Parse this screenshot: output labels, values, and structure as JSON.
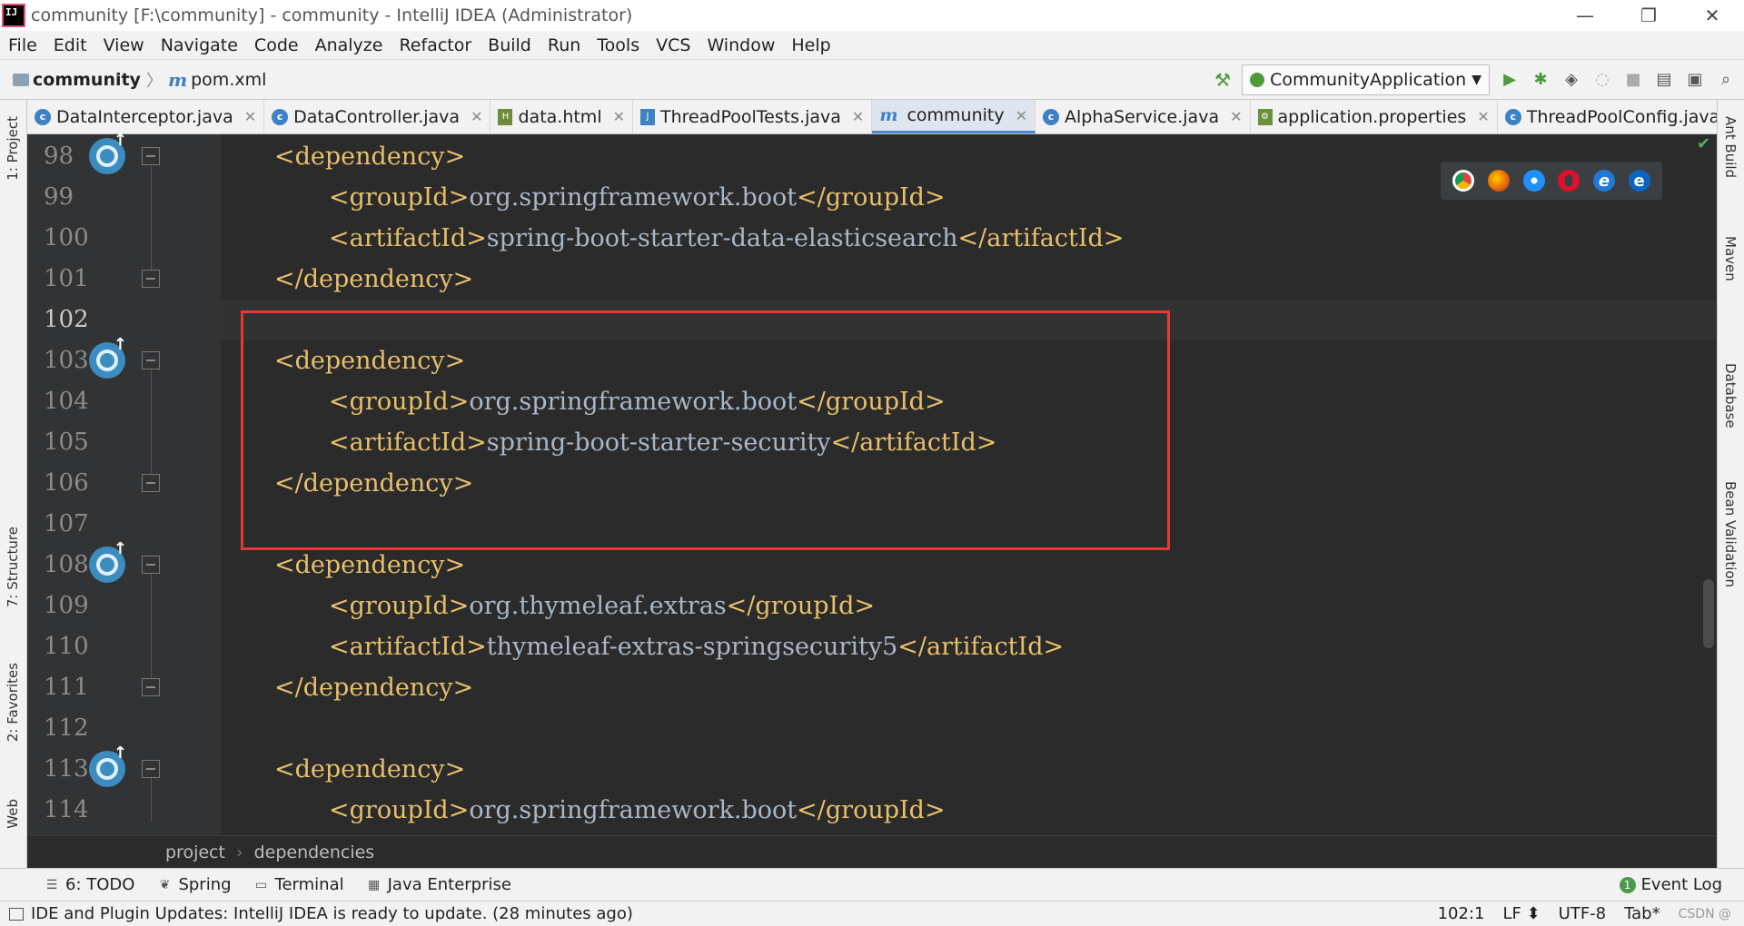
{
  "window": {
    "title": "community [F:\\community] - community - IntelliJ IDEA (Administrator)",
    "minimize": "—",
    "restore": "❐",
    "close": "✕"
  },
  "menu": [
    "File",
    "Edit",
    "View",
    "Navigate",
    "Code",
    "Analyze",
    "Refactor",
    "Build",
    "Run",
    "Tools",
    "VCS",
    "Window",
    "Help"
  ],
  "navbar": {
    "project": "community",
    "file": "pom.xml",
    "run_config": "CommunityApplication"
  },
  "tabs": [
    {
      "label": "DataInterceptor.java",
      "icon": "class-icon",
      "active": false
    },
    {
      "label": "DataController.java",
      "icon": "class-icon",
      "active": false
    },
    {
      "label": "data.html",
      "icon": "html-icon",
      "active": false
    },
    {
      "label": "ThreadPoolTests.java",
      "icon": "test-icon",
      "active": false
    },
    {
      "label": "community",
      "icon": "maven-icon",
      "active": true
    },
    {
      "label": "AlphaService.java",
      "icon": "class-icon",
      "active": false
    },
    {
      "label": "application.properties",
      "icon": "properties-icon",
      "active": false
    },
    {
      "label": "ThreadPoolConfig.java",
      "icon": "class-icon",
      "active": false
    }
  ],
  "tab_overflow": "3",
  "left_tools": {
    "project": "1: Project",
    "structure": "7: Structure",
    "favorites": "2: Favorites",
    "web": "Web"
  },
  "right_tools": {
    "ant": "Ant Build",
    "maven": "Maven",
    "database": "Database",
    "bean": "Bean Validation"
  },
  "code": [
    {
      "num": "98",
      "indent": 1,
      "open": "<",
      "tag": "dependency",
      "close": ">",
      "text": "",
      "end": ""
    },
    {
      "num": "99",
      "indent": 2,
      "open": "<",
      "tag": "groupId",
      "close": ">",
      "text": "org.springframework.boot",
      "end": "</groupId>"
    },
    {
      "num": "100",
      "indent": 2,
      "open": "<",
      "tag": "artifactId",
      "close": ">",
      "text": "spring-boot-starter-data-elasticsearch",
      "end": "</artifactId>"
    },
    {
      "num": "101",
      "indent": 1,
      "open": "</",
      "tag": "dependency",
      "close": ">",
      "text": "",
      "end": ""
    },
    {
      "num": "102",
      "indent": 0,
      "open": "",
      "tag": "",
      "close": "",
      "text": "",
      "end": ""
    },
    {
      "num": "103",
      "indent": 1,
      "open": "<",
      "tag": "dependency",
      "close": ">",
      "text": "",
      "end": ""
    },
    {
      "num": "104",
      "indent": 2,
      "open": "<",
      "tag": "groupId",
      "close": ">",
      "text": "org.springframework.boot",
      "end": "</groupId>"
    },
    {
      "num": "105",
      "indent": 2,
      "open": "<",
      "tag": "artifactId",
      "close": ">",
      "text": "spring-boot-starter-security",
      "end": "</artifactId>"
    },
    {
      "num": "106",
      "indent": 1,
      "open": "</",
      "tag": "dependency",
      "close": ">",
      "text": "",
      "end": ""
    },
    {
      "num": "107",
      "indent": 0,
      "open": "",
      "tag": "",
      "close": "",
      "text": "",
      "end": ""
    },
    {
      "num": "108",
      "indent": 1,
      "open": "<",
      "tag": "dependency",
      "close": ">",
      "text": "",
      "end": ""
    },
    {
      "num": "109",
      "indent": 2,
      "open": "<",
      "tag": "groupId",
      "close": ">",
      "text": "org.thymeleaf.extras",
      "end": "</groupId>"
    },
    {
      "num": "110",
      "indent": 2,
      "open": "<",
      "tag": "artifactId",
      "close": ">",
      "text": "thymeleaf-extras-springsecurity5",
      "end": "</artifactId>"
    },
    {
      "num": "111",
      "indent": 1,
      "open": "</",
      "tag": "dependency",
      "close": ">",
      "text": "",
      "end": ""
    },
    {
      "num": "112",
      "indent": 0,
      "open": "",
      "tag": "",
      "close": "",
      "text": "",
      "end": ""
    },
    {
      "num": "113",
      "indent": 1,
      "open": "<",
      "tag": "dependency",
      "close": ">",
      "text": "",
      "end": ""
    },
    {
      "num": "114",
      "indent": 2,
      "open": "<",
      "tag": "groupId",
      "close": ">",
      "text": "org.springframework.boot",
      "end": "</groupId>"
    }
  ],
  "current_line": "102",
  "breadcrumb": [
    "project",
    "dependencies"
  ],
  "bottom_tools": [
    {
      "label": "6: TODO",
      "icon": "list-icon"
    },
    {
      "label": "Spring",
      "icon": "spring-icon"
    },
    {
      "label": "Terminal",
      "icon": "terminal-icon"
    },
    {
      "label": "Java Enterprise",
      "icon": "java-enterprise-icon"
    }
  ],
  "event_log": {
    "label": "Event Log",
    "count": "1"
  },
  "status": {
    "message": "IDE and Plugin Updates: IntelliJ IDEA is ready to update. (28 minutes ago)",
    "position": "102:1",
    "line_sep": "LF ⬍",
    "encoding": "UTF-8",
    "indent": "Tab*",
    "watermark": "CSDN @"
  },
  "colors": {
    "accent": "#4a88c7",
    "tag": "#e8bf6a",
    "text": "#a9b7c6",
    "highlight": "#e53935"
  }
}
